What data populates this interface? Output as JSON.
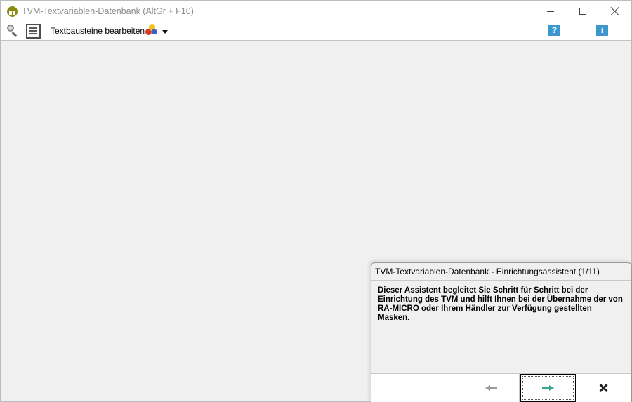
{
  "window": {
    "title": "TVM-Textvariablen-Datenbank (AltGr + F10)",
    "app_icon": "tvm-app-icon",
    "controls": [
      "minimize-icon",
      "maximize-icon",
      "close-icon"
    ]
  },
  "toolbar": {
    "search_icon": "magnifier-icon",
    "document_icon": "document-icon",
    "edit_label": "Textbausteine bearbeiten",
    "tools_icon": "tools-icon",
    "dropdown_icon": "chevron-down-icon",
    "help_label": "?",
    "info_label": "i"
  },
  "wizard": {
    "title": "TVM-Textvariablen-Datenbank - Einrichtungsassistent (1/11)",
    "body_text": "Dieser Assistent begleitet Sie Schritt für Schritt bei der Einrichtung des TVM und hilft Ihnen bei der Übernahme der von RA-MICRO oder Ihrem Händler zur Verfügung gestellten Masken.",
    "buttons": [
      "arrow-left-icon",
      "arrow-right-icon",
      "close-x-icon"
    ],
    "colors": {
      "next_arrow": "#37a88e",
      "back_arrow": "#9a9a9a"
    }
  }
}
